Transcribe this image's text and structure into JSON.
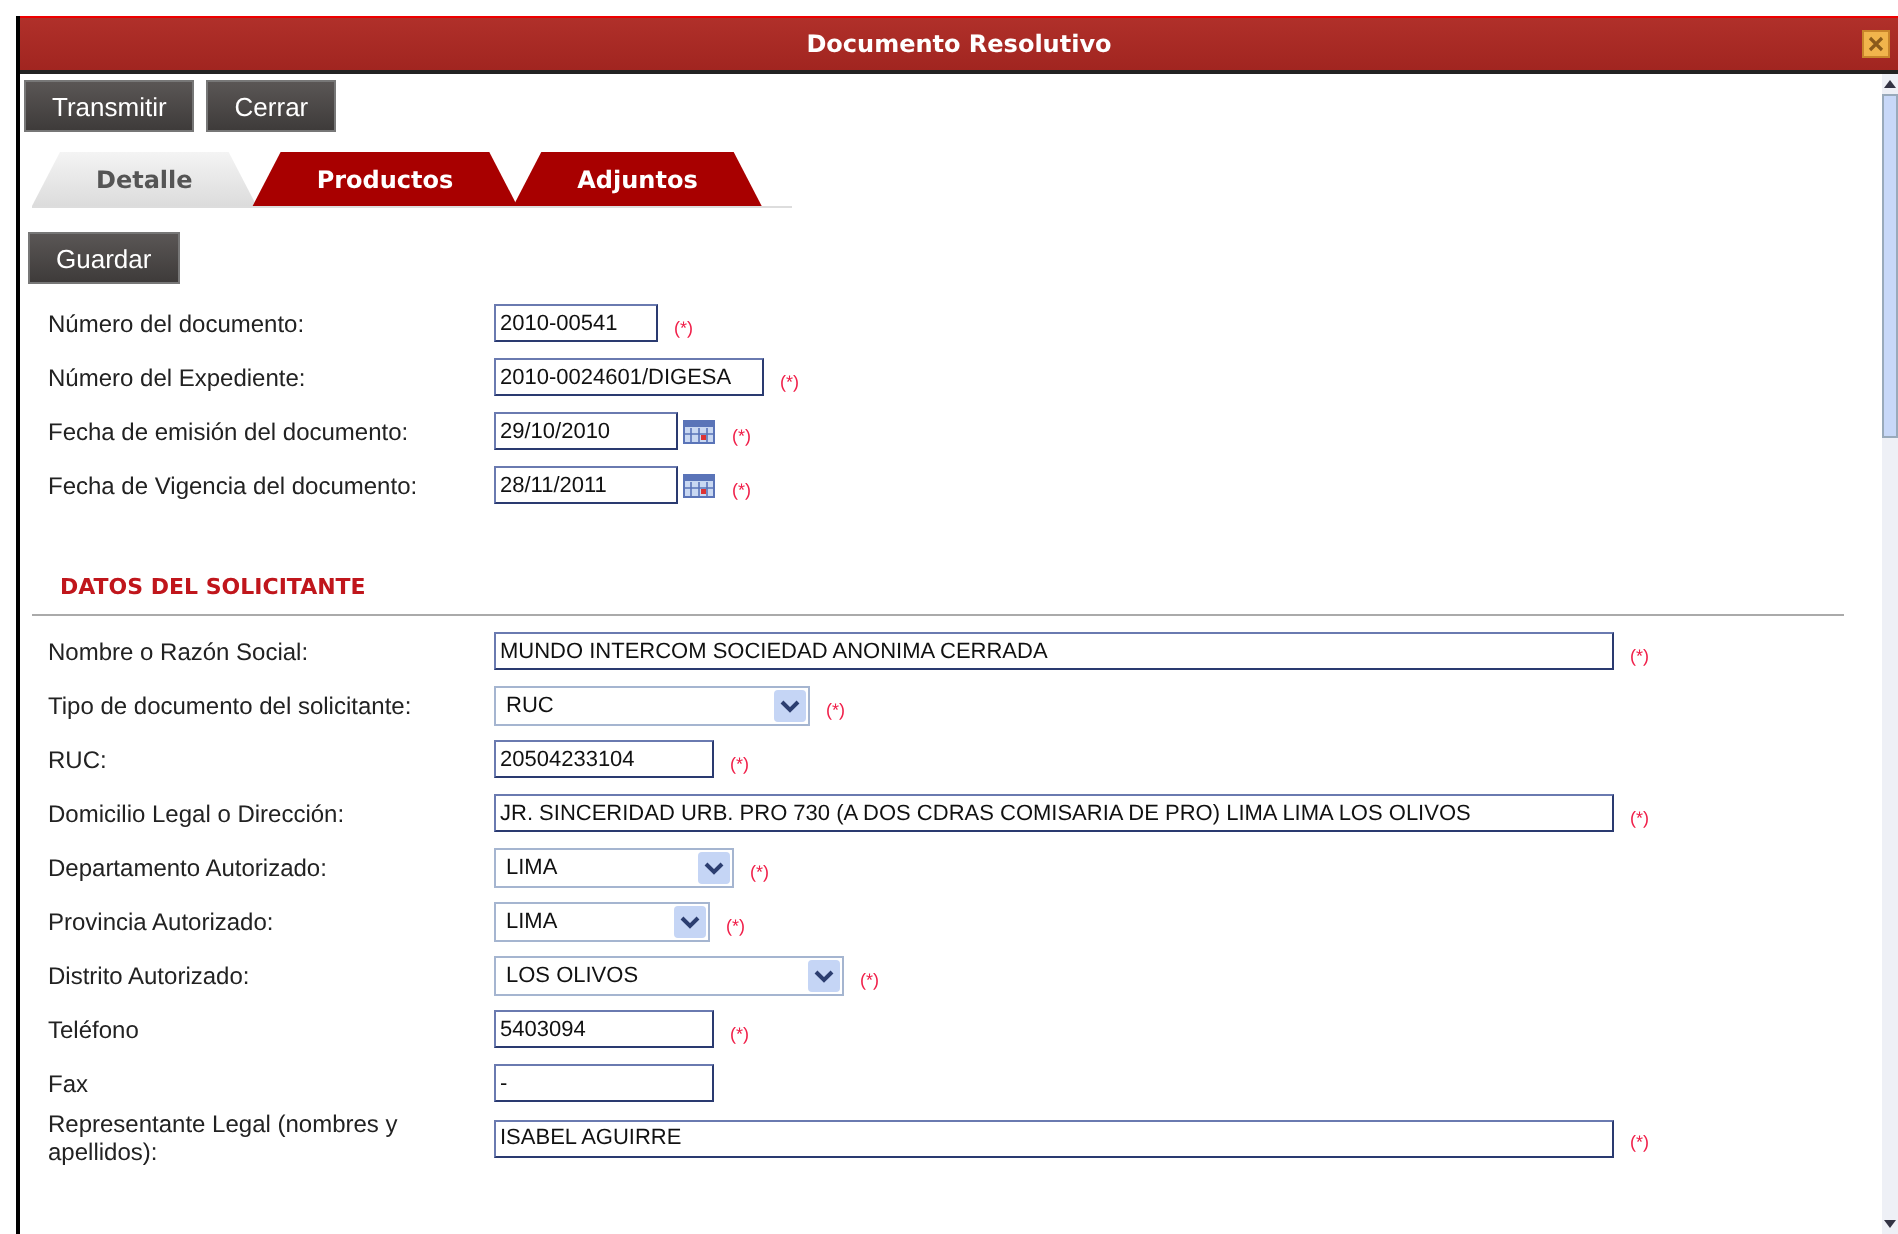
{
  "window": {
    "title": "Documento Resolutivo"
  },
  "toolbar": [
    "Transmitir",
    "Cerrar"
  ],
  "tabs": [
    {
      "label": "Detalle",
      "selected": true
    },
    {
      "label": "Productos",
      "selected": false
    },
    {
      "label": "Adjuntos",
      "selected": false
    }
  ],
  "save_button": "Guardar",
  "document_fields": [
    {
      "kind": "text",
      "label": "Número del documento:",
      "value": "2010-00541",
      "required_mark": "(*)"
    },
    {
      "kind": "text",
      "label": "Número del Expediente:",
      "value": "2010-0024601/DIGESA",
      "required_mark": "(*)"
    },
    {
      "kind": "date",
      "label": "Fecha de emisión del documento:",
      "value": "29/10/2010",
      "required_mark": "(*)"
    },
    {
      "kind": "date",
      "label": "Fecha de Vigencia del documento:",
      "value": "28/11/2011",
      "required_mark": "(*)"
    }
  ],
  "applicant_section": {
    "heading": "DATOS DEL SOLICITANTE",
    "fields": [
      {
        "kind": "text",
        "label": "Nombre o Razón Social:",
        "value": "MUNDO INTERCOM SOCIEDAD ANONIMA CERRADA",
        "required_mark": "(*)"
      },
      {
        "kind": "select",
        "label": "Tipo de documento del solicitante:",
        "value": "RUC",
        "required_mark": "(*)"
      },
      {
        "kind": "text",
        "label": "RUC:",
        "value": "20504233104",
        "required_mark": "(*)"
      },
      {
        "kind": "text",
        "label": "Domicilio Legal o Dirección:",
        "value": "JR. SINCERIDAD URB. PRO 730 (A DOS CDRAS COMISARIA DE PRO) LIMA LIMA LOS OLIVOS",
        "required_mark": "(*)"
      },
      {
        "kind": "select",
        "label": "Departamento Autorizado:",
        "value": "LIMA",
        "required_mark": "(*)"
      },
      {
        "kind": "select",
        "label": "Provincia Autorizado:",
        "value": "LIMA",
        "required_mark": "(*)"
      },
      {
        "kind": "select",
        "label": "Distrito Autorizado:",
        "value": "LOS OLIVOS",
        "required_mark": "(*)"
      },
      {
        "kind": "text",
        "label": "Teléfono",
        "value": "5403094",
        "required_mark": "(*)"
      },
      {
        "kind": "text",
        "label": "Fax",
        "value": "-"
      },
      {
        "kind": "text",
        "label": "Representante Legal (nombres y apellidos):",
        "value": "ISABEL AGUIRRE",
        "required_mark": "(*)"
      }
    ]
  }
}
